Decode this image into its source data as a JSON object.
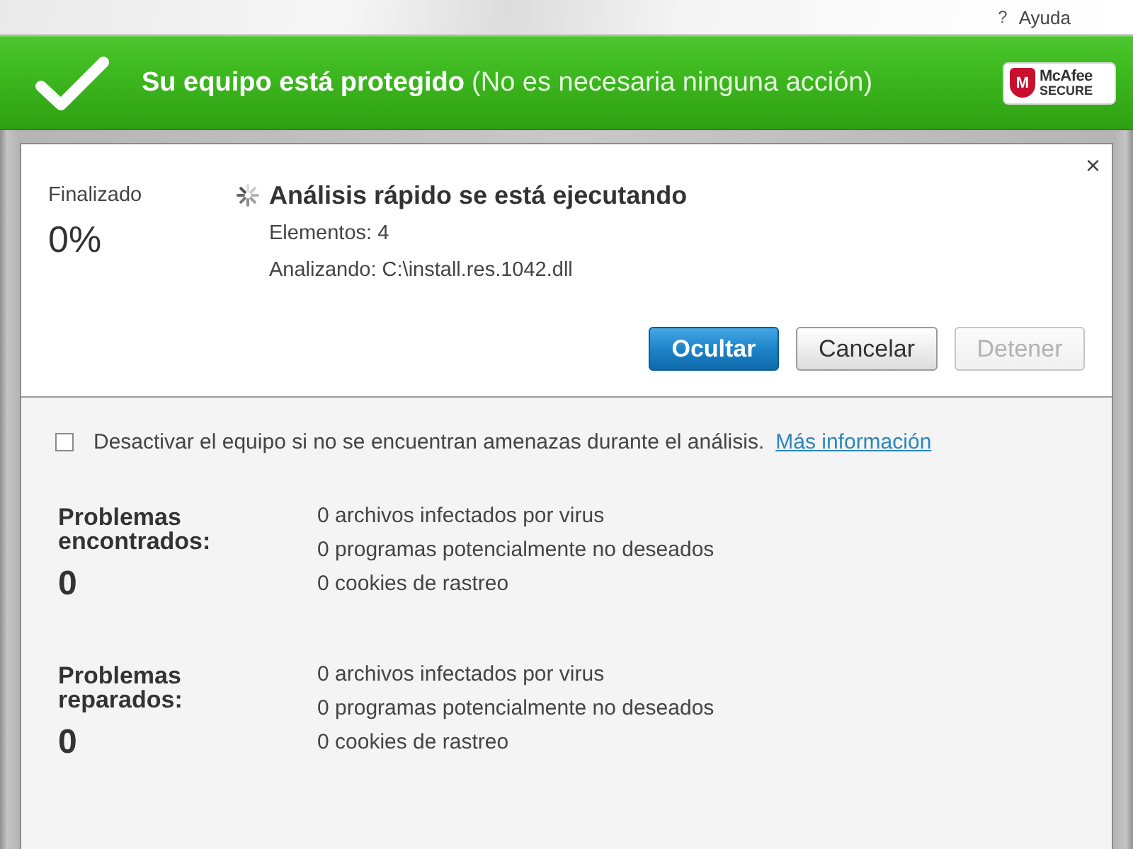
{
  "help": {
    "icon": "?",
    "label": "Ayuda"
  },
  "banner": {
    "protected": true,
    "title": "Su equipo está protegido",
    "note": "(No es necesaria ninguna acción)",
    "badge": {
      "mark": "M",
      "line_1": "McAfee",
      "line_2": "SECURE"
    }
  },
  "dialog": {
    "close": "×",
    "progress_label": "Finalizado",
    "progress": "0%",
    "running": true,
    "title": "Análisis rápido se está ejecutando",
    "details": [
      "Elementos: 4",
      "Analizando: C:\\install.res.1042.dll"
    ],
    "buttons": [
      {
        "label": "Ocultar",
        "kind": "primary",
        "disabled": false
      },
      {
        "label": "Cancelar",
        "kind": "normal",
        "disabled": false
      },
      {
        "label": "Detener",
        "kind": "normal",
        "disabled": true
      }
    ]
  },
  "option": {
    "checked": false,
    "label": "Desactivar el equipo si no se encuentran amenazas durante el análisis.",
    "link": "Más información"
  },
  "groups": [
    {
      "title": "Problemas encontrados:",
      "count": "0",
      "items": [
        "0 archivos infectados por virus",
        "0 programas potencialmente no deseados",
        "0 cookies de rastreo"
      ]
    },
    {
      "title": "Problemas reparados:",
      "count": "0",
      "items": [
        "0 archivos infectados por virus",
        "0 programas potencialmente no deseados",
        "0 cookies de rastreo"
      ]
    }
  ]
}
